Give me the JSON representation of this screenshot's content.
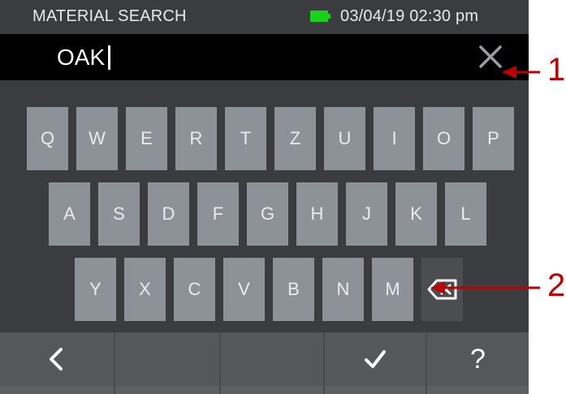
{
  "status": {
    "title": "MATERIAL SEARCH",
    "datetime": "03/04/19 02:30 pm",
    "battery_color": "#19d31a"
  },
  "search": {
    "value": "OAK",
    "clear_icon": "close-icon"
  },
  "keyboard": {
    "row1": [
      "Q",
      "W",
      "E",
      "R",
      "T",
      "Z",
      "U",
      "I",
      "O",
      "P"
    ],
    "row2": [
      "A",
      "S",
      "D",
      "F",
      "G",
      "H",
      "J",
      "K",
      "L"
    ],
    "row3": [
      "Y",
      "X",
      "C",
      "V",
      "B",
      "N",
      "M"
    ],
    "backspace_icon": "backspace-icon"
  },
  "softkeys": {
    "back_icon": "chevron-left-icon",
    "confirm_icon": "check-icon",
    "help_label": "?"
  },
  "callouts": {
    "one": "1",
    "two": "2",
    "color": "#c00000"
  }
}
